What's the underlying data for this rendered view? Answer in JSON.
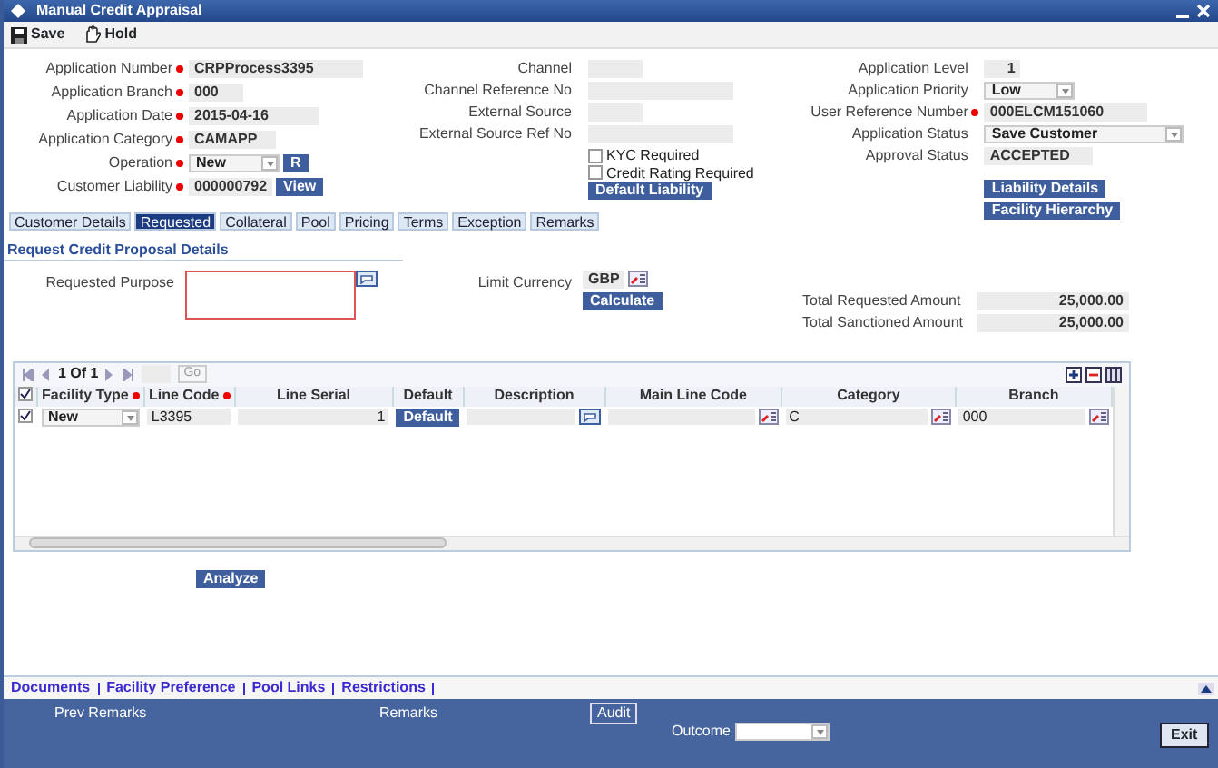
{
  "window": {
    "title": "Manual Credit Appraisal"
  },
  "toolbar": [
    {
      "kind": "save",
      "label": "Save"
    },
    {
      "kind": "hold",
      "label": "Hold"
    }
  ],
  "header_left": [
    {
      "kind": "text",
      "label": "Application Number",
      "required": true,
      "value": "CRPProcess3395"
    },
    {
      "kind": "text",
      "label": "Application Branch",
      "required": true,
      "value": "000"
    },
    {
      "kind": "text",
      "label": "Application Date",
      "required": true,
      "value": "2015-04-16"
    },
    {
      "kind": "text",
      "label": "Application Category",
      "required": true,
      "value": "CAMAPP"
    },
    {
      "kind": "select",
      "label": "Operation",
      "required": true,
      "value": "New",
      "button": "R"
    },
    {
      "kind": "button",
      "label": "Customer Liability",
      "required": true,
      "value": "000000792",
      "button": "View"
    }
  ],
  "header_middle": [
    {
      "kind": "text",
      "label": "Channel",
      "required": false
    },
    {
      "kind": "text",
      "label": "Channel Reference No",
      "required": false
    },
    {
      "kind": "text",
      "label": "External Source",
      "required": false
    },
    {
      "kind": "text",
      "label": "External Source Ref No",
      "required": false
    }
  ],
  "checkboxes": [
    {
      "label": "KYC Required",
      "checked": false
    },
    {
      "label": "Credit Rating Required",
      "checked": false
    }
  ],
  "middle_button": "Default Liability",
  "header_right": [
    {
      "kind": "number",
      "label": "Application Level",
      "required": false,
      "value": "1"
    },
    {
      "kind": "select",
      "label": "Application Priority",
      "required": false,
      "value": "Low"
    },
    {
      "kind": "text",
      "label": "User Reference Number",
      "required": true,
      "value": "000ELCM151060"
    },
    {
      "kind": "select",
      "label": "Application Status",
      "required": false,
      "value": "Save Customer"
    },
    {
      "kind": "text",
      "label": "Approval Status",
      "required": false,
      "value": "ACCEPTED"
    }
  ],
  "right_buttons": [
    "Liability Details",
    "Facility Hierarchy"
  ],
  "tabs": [
    {
      "label": "Customer Details",
      "selected": false
    },
    {
      "label": "Requested",
      "selected": true
    },
    {
      "label": "Collateral",
      "selected": false
    },
    {
      "label": "Pool",
      "selected": false
    },
    {
      "label": "Pricing",
      "selected": false
    },
    {
      "label": "Terms",
      "selected": false
    },
    {
      "label": "Exception",
      "selected": false
    },
    {
      "label": "Remarks",
      "selected": false
    }
  ],
  "section_title": "Request Credit Proposal Details",
  "requested_purpose": {
    "label": "Requested Purpose"
  },
  "limit_currency": {
    "label": "Limit Currency",
    "value": "GBP"
  },
  "calculate_button": "Calculate",
  "totals": [
    {
      "label": "Total Requested Amount",
      "value": "25,000.00"
    },
    {
      "label": "Total Sanctioned Amount",
      "value": "25,000.00"
    }
  ],
  "grid": {
    "pager": "1 Of 1",
    "go": "Go",
    "columns": [
      {
        "label": "Facility Type",
        "required": true
      },
      {
        "label": "Line Code",
        "required": true
      },
      {
        "label": "Line Serial",
        "required": false
      },
      {
        "label": "Default",
        "required": false
      },
      {
        "label": "Description",
        "required": false
      },
      {
        "label": "Main Line Code",
        "required": false
      },
      {
        "label": "Category",
        "required": false
      },
      {
        "label": "Branch",
        "required": false
      }
    ],
    "header_checked": true,
    "rows": [
      {
        "checked": true,
        "facility_type": "New",
        "line_code": "L3395",
        "line_serial": "1",
        "default": "Default",
        "category": "C",
        "branch": "000"
      }
    ]
  },
  "analyze_button": "Analyze",
  "footer_links": [
    "Documents",
    "Facility Preference",
    "Pool Links",
    "Restrictions"
  ],
  "bottom_bar": {
    "prev_remarks": "Prev Remarks",
    "remarks": "Remarks",
    "audit": "Audit",
    "outcome_label": "Outcome",
    "exit": "Exit"
  }
}
